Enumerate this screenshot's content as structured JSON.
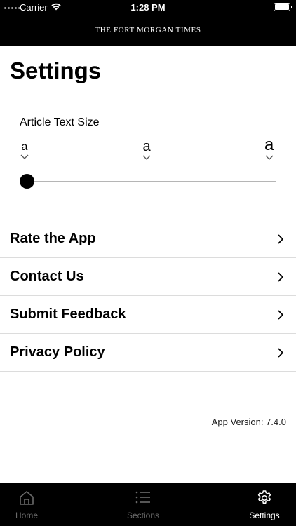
{
  "status_bar": {
    "carrier": "Carrier",
    "time": "1:28 PM",
    "icons": [
      "signal-dots-icon",
      "wifi-icon",
      "battery-icon"
    ]
  },
  "header": {
    "masthead": "THE FORT MORGAN TIMES"
  },
  "page": {
    "title": "Settings"
  },
  "text_size": {
    "label": "Article Text Size",
    "options": [
      {
        "letter": "a",
        "level": "small"
      },
      {
        "letter": "a",
        "level": "medium"
      },
      {
        "letter": "a",
        "level": "large"
      }
    ],
    "selected_index": 0
  },
  "menu": {
    "items": [
      {
        "label": "Rate the App"
      },
      {
        "label": "Contact Us"
      },
      {
        "label": "Submit Feedback"
      },
      {
        "label": "Privacy Policy"
      }
    ]
  },
  "footer": {
    "version": "App Version: 7.4.0"
  },
  "tabbar": {
    "tabs": [
      {
        "label": "Home",
        "icon": "home-icon",
        "active": false
      },
      {
        "label": "Sections",
        "icon": "list-icon",
        "active": false
      },
      {
        "label": "Settings",
        "icon": "gear-icon",
        "active": true
      }
    ]
  },
  "colors": {
    "header_bg": "#000000",
    "tab_active": "#ffffff",
    "tab_inactive": "#6b6b6b",
    "divider": "#dcdcdc"
  }
}
